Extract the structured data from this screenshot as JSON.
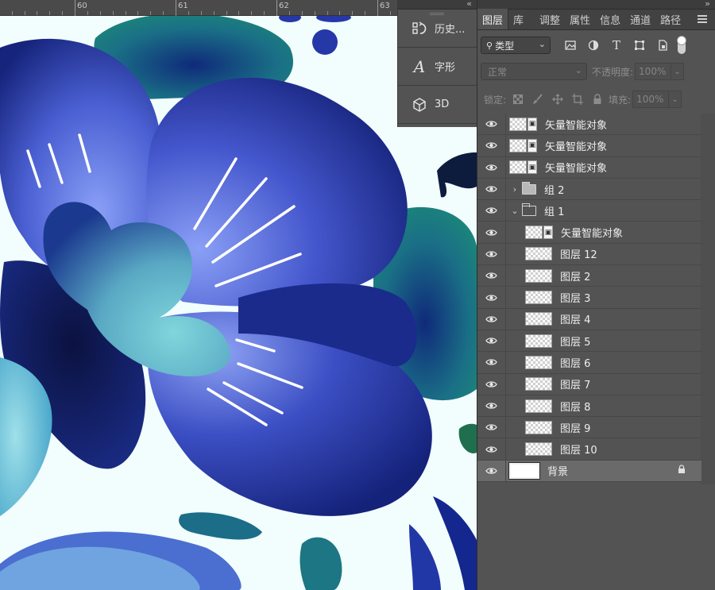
{
  "ruler": {
    "marks": [
      "60",
      "61",
      "62",
      "63"
    ]
  },
  "mini_panels": {
    "collapse_glyph": "‹‹",
    "items": [
      {
        "label": "历史...",
        "icon": "history-icon"
      },
      {
        "label": "字形",
        "icon": "glyphs-icon"
      },
      {
        "label": "3D",
        "icon": "3d-cube-icon"
      }
    ]
  },
  "panel": {
    "collapse_glyph": "››",
    "tabs": [
      "图层",
      "库",
      "调整",
      "属性",
      "信息",
      "通道",
      "路径"
    ],
    "active_tab": "图层"
  },
  "filter": {
    "kind_label": "类型",
    "icons": [
      "image-filter-icon",
      "adjustment-filter-icon",
      "type-filter-icon",
      "shape-filter-icon",
      "smart-object-filter-icon"
    ]
  },
  "blend": {
    "mode": "正常",
    "opacity_label": "不透明度:",
    "opacity_value": "100%"
  },
  "lock": {
    "label": "锁定:",
    "fill_label": "填充:",
    "fill_value": "100%"
  },
  "layers": [
    {
      "name": "矢量智能对象",
      "type": "smart",
      "indent": 0
    },
    {
      "name": "矢量智能对象",
      "type": "smart",
      "indent": 0
    },
    {
      "name": "矢量智能对象",
      "type": "smart",
      "indent": 0
    },
    {
      "name": "组 2",
      "type": "group-closed",
      "indent": 0
    },
    {
      "name": "组 1",
      "type": "group-open",
      "indent": 0
    },
    {
      "name": "矢量智能对象",
      "type": "smart",
      "indent": 1
    },
    {
      "name": "图层 12",
      "type": "pixel",
      "indent": 1
    },
    {
      "name": "图层 2",
      "type": "pixel",
      "indent": 1
    },
    {
      "name": "图层 3",
      "type": "pixel",
      "indent": 1
    },
    {
      "name": "图层 4",
      "type": "pixel",
      "indent": 1
    },
    {
      "name": "图层 5",
      "type": "pixel",
      "indent": 1
    },
    {
      "name": "图层 6",
      "type": "pixel",
      "indent": 1
    },
    {
      "name": "图层 7",
      "type": "pixel",
      "indent": 1
    },
    {
      "name": "图层 8",
      "type": "pixel",
      "indent": 1
    },
    {
      "name": "图层 9",
      "type": "pixel",
      "indent": 1
    },
    {
      "name": "图层 10",
      "type": "pixel",
      "indent": 1
    },
    {
      "name": "背景",
      "type": "background",
      "indent": 0,
      "locked": true
    }
  ],
  "colors": {
    "canvas_bg": "#f2fdfd",
    "navy": "#14237a",
    "blue": "#2b40b8",
    "periwinkle": "#7b92f2",
    "teal": "#1c7b79",
    "light_teal": "#77cfd6",
    "panel_bg": "#535353"
  }
}
